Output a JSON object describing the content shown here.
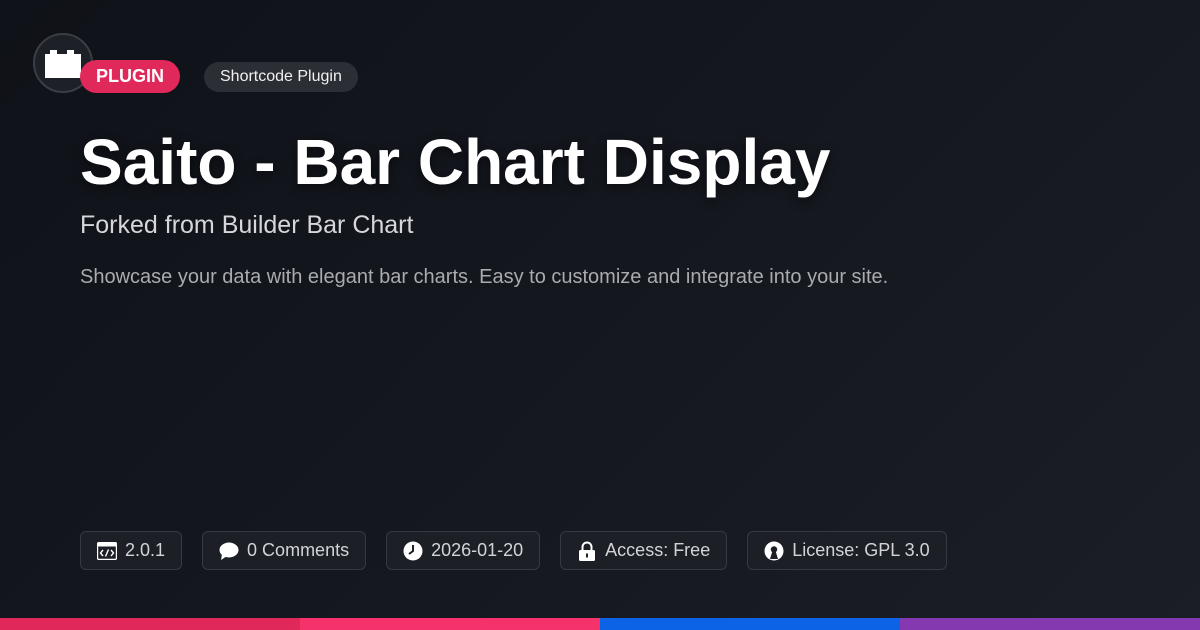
{
  "badges": {
    "category": "PLUGIN",
    "type": "Shortcode Plugin"
  },
  "header": {
    "title": "Saito - Bar Chart Display",
    "subtitle": "Forked from Builder Bar Chart",
    "description": "Showcase your data with elegant bar charts. Easy to customize and integrate into your site."
  },
  "meta": {
    "version": "2.0.1",
    "comments": "0 Comments",
    "date": "2026-01-20",
    "access": "Access: Free",
    "license": "License: GPL 3.0"
  },
  "icons": {
    "logo": "plugin-block-icon",
    "version": "code-window-icon",
    "comments": "speech-bubble-icon",
    "date": "clock-icon",
    "access": "lock-icon",
    "license": "open-source-icon"
  },
  "colors": {
    "badge_accent": "#e0285a",
    "stripes": [
      "#e0285a",
      "#f5336a",
      "#0d63e6",
      "#8439b1"
    ]
  }
}
